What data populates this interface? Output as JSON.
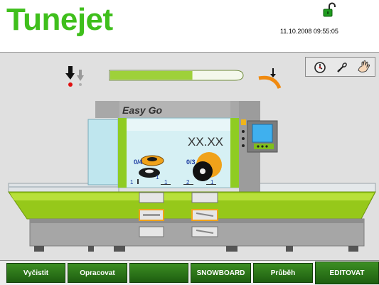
{
  "header": {
    "logo_text": "Tunejet",
    "datetime": "11.10.2008 09:55:05"
  },
  "machine": {
    "model_label": "Easy Go",
    "counter_display": "XX.XX",
    "spool_a_label": "0/4",
    "spool_b_label": "0/3",
    "scale_labels": [
      "1",
      "1",
      "1",
      "2",
      "1"
    ],
    "progress_level": 0.62
  },
  "tools": [
    "timer-icon",
    "plug-icon",
    "hand-icon"
  ],
  "buttons": [
    "Vyčistit",
    "Opracovat",
    "",
    "SNOWBOARD",
    "Průběh",
    "EDITOVAT"
  ],
  "colors": {
    "brand_green": "#3fbf1c",
    "button_green": "#2f7a1c",
    "machine_lime": "#96c81a",
    "glass_blue": "#bfe6ee",
    "accent_orange": "#f0a21a"
  }
}
